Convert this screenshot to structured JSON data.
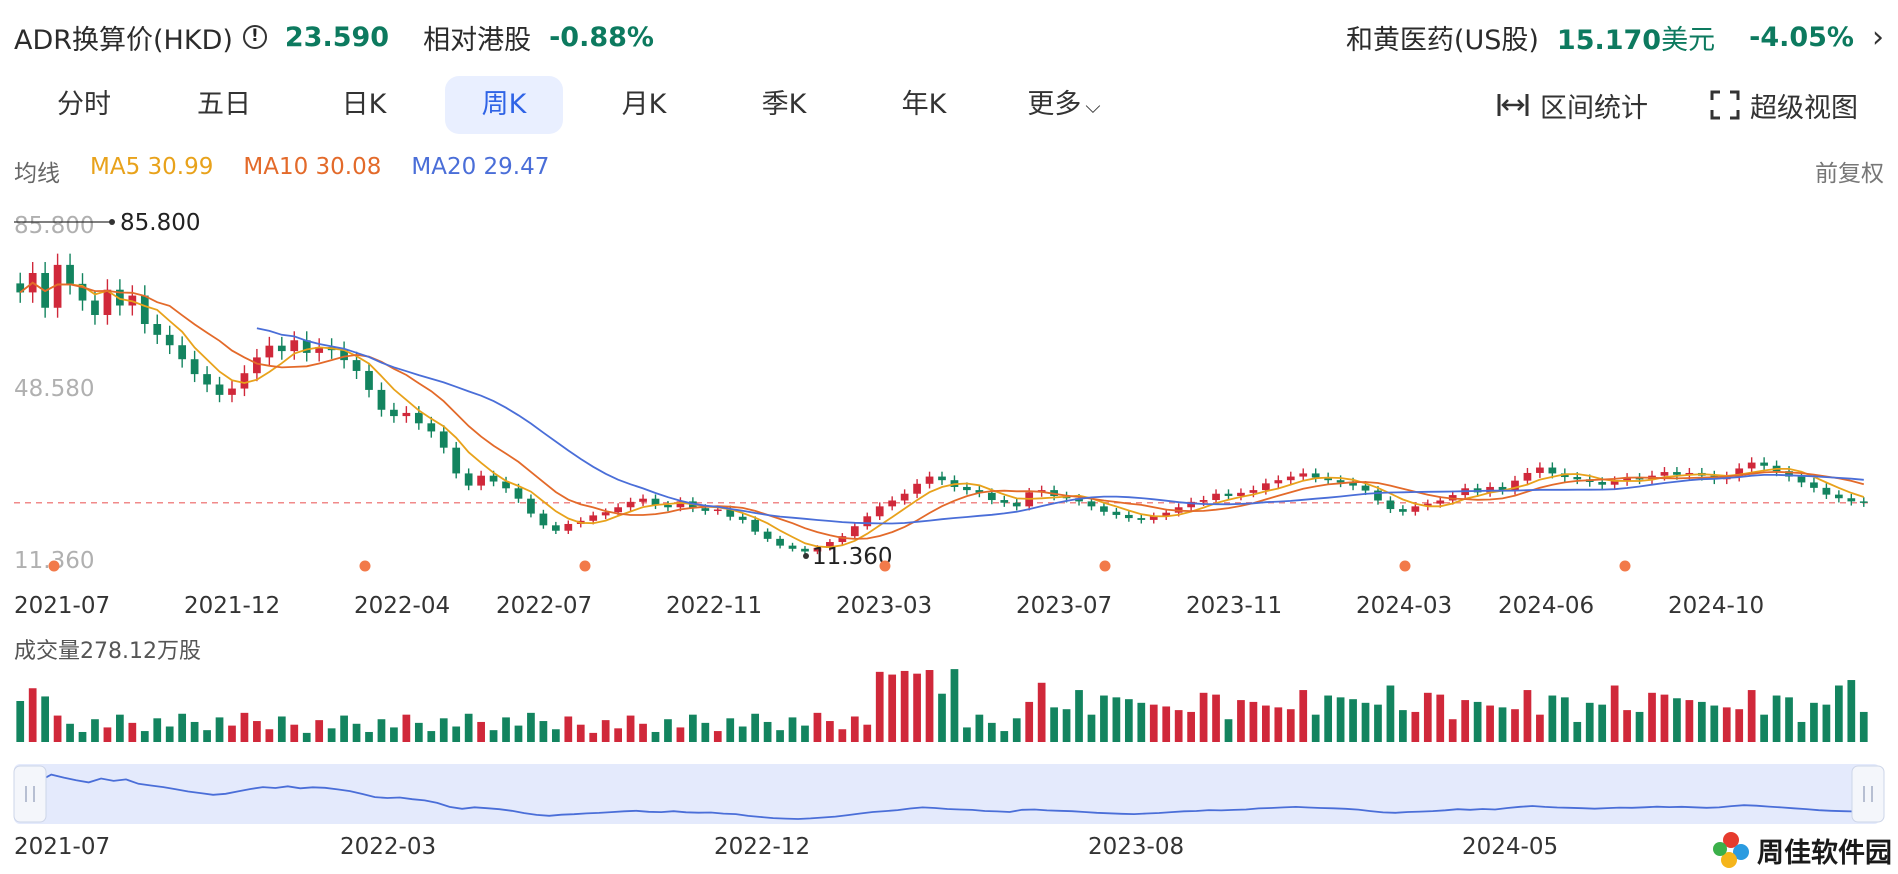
{
  "header": {
    "adr_label": "ADR换算价(HKD)",
    "adr_price": "23.590",
    "rel_label": "相对港股",
    "rel_pct": "-0.88%",
    "stock_name": "和黄医药(US股)",
    "us_price": "15.170",
    "us_unit": "美元",
    "us_pct": "-4.05%"
  },
  "tabs": [
    "分时",
    "五日",
    "日K",
    "周K",
    "月K",
    "季K",
    "年K",
    "更多"
  ],
  "active_tab": "周K",
  "tools": {
    "range_stats": "区间统计",
    "super_view": "超级视图"
  },
  "ma": {
    "label": "均线",
    "ma5": "MA5 30.99",
    "ma10": "MA10 30.08",
    "ma20": "MA20 29.47"
  },
  "adjust_label": "前复权",
  "volume_label": "成交量278.12万股",
  "watermark": "周佳软件园",
  "colors": {
    "up": "#d0283a",
    "down": "#13845f",
    "ma5": "#e8a21b",
    "ma10": "#e36a2a",
    "ma20": "#4a6ed8",
    "accent": "#2f63e6"
  },
  "chart_data": {
    "type": "candlestick",
    "price_axis": {
      "top": "85.800",
      "mid": "48.580",
      "bottom": "11.360"
    },
    "annotations": {
      "max": "85.800",
      "min": "11.360"
    },
    "x_ticks": [
      "2021-07",
      "2021-12",
      "2022-04",
      "2022-07",
      "2022-11",
      "2023-03",
      "2023-07",
      "2023-11",
      "2024-03",
      "2024-06",
      "2024-10"
    ],
    "ylim": [
      11.36,
      85.8
    ],
    "current_price": 23.59,
    "close_series": [
      70.2,
      74.5,
      66.8,
      76.3,
      72.1,
      68.4,
      65.2,
      70.8,
      67.3,
      69.5,
      63.2,
      60.8,
      58.5,
      55.4,
      52.1,
      49.8,
      47.5,
      48.9,
      52.3,
      55.8,
      58.4,
      57.2,
      59.6,
      56.8,
      58.1,
      57.4,
      55.2,
      52.8,
      48.6,
      44.2,
      42.8,
      43.5,
      41.2,
      39.4,
      35.8,
      30.1,
      27.4,
      29.6,
      28.3,
      26.8,
      24.5,
      21.2,
      18.6,
      17.4,
      18.9,
      19.6,
      20.8,
      21.5,
      22.6,
      23.8,
      24.5,
      23.1,
      22.6,
      23.9,
      22.4,
      21.8,
      22.1,
      20.5,
      19.8,
      17.2,
      15.6,
      14.1,
      13.4,
      12.8,
      13.6,
      14.9,
      16.2,
      18.4,
      20.6,
      22.8,
      24.1,
      25.6,
      27.8,
      29.4,
      28.6,
      27.1,
      26.4,
      25.8,
      24.2,
      23.6,
      22.8,
      25.9,
      26.4,
      25.1,
      24.6,
      23.9,
      22.8,
      21.6,
      20.9,
      20.2,
      19.8,
      20.6,
      21.4,
      22.6,
      23.8,
      24.2,
      25.6,
      25.1,
      25.8,
      26.4,
      27.9,
      28.6,
      29.4,
      30.1,
      29.2,
      28.6,
      28.1,
      27.4,
      26.3,
      24.1,
      22.2,
      21.6,
      22.8,
      23.4,
      24.1,
      25.3,
      26.8,
      25.9,
      27.1,
      26.4,
      28.5,
      30.2,
      31.4,
      30.1,
      29.3,
      28.8,
      28.2,
      27.6,
      28.4,
      29.1,
      28.8,
      29.6,
      30.4,
      29.8,
      30.2,
      29.6,
      28.8,
      29.4,
      31.2,
      32.5,
      31.8,
      30.6,
      29.4,
      28.1,
      26.9,
      25.4,
      24.6,
      23.9,
      23.59
    ],
    "volume_label": "成交量278.12万股",
    "range_ticks": [
      "2021-07",
      "2022-03",
      "2022-12",
      "2023-08",
      "2024-05"
    ]
  }
}
